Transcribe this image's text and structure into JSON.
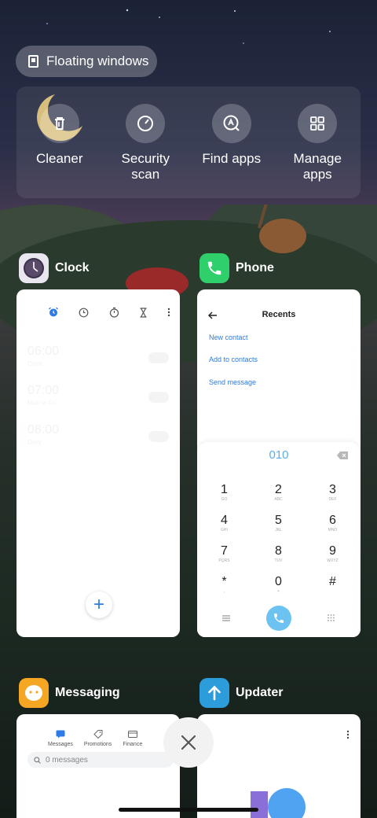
{
  "floating_windows": {
    "label": "Floating windows",
    "icon": "floating-window-icon"
  },
  "tools": [
    {
      "id": "cleaner",
      "label": "Cleaner",
      "icon": "trash-icon"
    },
    {
      "id": "security-scan",
      "label": "Security scan",
      "icon": "speedometer-icon"
    },
    {
      "id": "find-apps",
      "label": "Find apps",
      "icon": "search-letter-icon"
    },
    {
      "id": "manage-apps",
      "label": "Manage apps",
      "icon": "grid-icon"
    }
  ],
  "apps": {
    "clock": {
      "name": "Clock",
      "accent": "#2e7be8",
      "tabs": [
        "alarm-icon",
        "clock-icon",
        "stopwatch-icon",
        "timer-icon",
        "more-icon"
      ],
      "alarms": [
        {
          "time": "06:00",
          "sub": "Once"
        },
        {
          "time": "07:00",
          "sub": "Mon to Fri"
        },
        {
          "time": "08:00",
          "sub": "Daily"
        }
      ],
      "fab": "+"
    },
    "phone": {
      "name": "Phone",
      "accent": "#2a7be0",
      "title": "Recents",
      "links": [
        "New contact",
        "Add to contacts",
        "Send message"
      ],
      "dialed": "010",
      "keys": [
        {
          "digit": "1",
          "letters": "GO"
        },
        {
          "digit": "2",
          "letters": "ABC"
        },
        {
          "digit": "3",
          "letters": "DEF"
        },
        {
          "digit": "4",
          "letters": "GHI"
        },
        {
          "digit": "5",
          "letters": "JKL"
        },
        {
          "digit": "6",
          "letters": "MNO"
        },
        {
          "digit": "7",
          "letters": "PQRS"
        },
        {
          "digit": "8",
          "letters": "TUV"
        },
        {
          "digit": "9",
          "letters": "WXYZ"
        },
        {
          "digit": "*",
          "letters": ","
        },
        {
          "digit": "0",
          "letters": "+"
        },
        {
          "digit": "#",
          "letters": ""
        }
      ]
    },
    "messaging": {
      "name": "Messaging",
      "tabs": [
        "Messages",
        "Promotions",
        "Finance"
      ],
      "search_placeholder": "0 messages"
    },
    "updater": {
      "name": "Updater"
    }
  }
}
